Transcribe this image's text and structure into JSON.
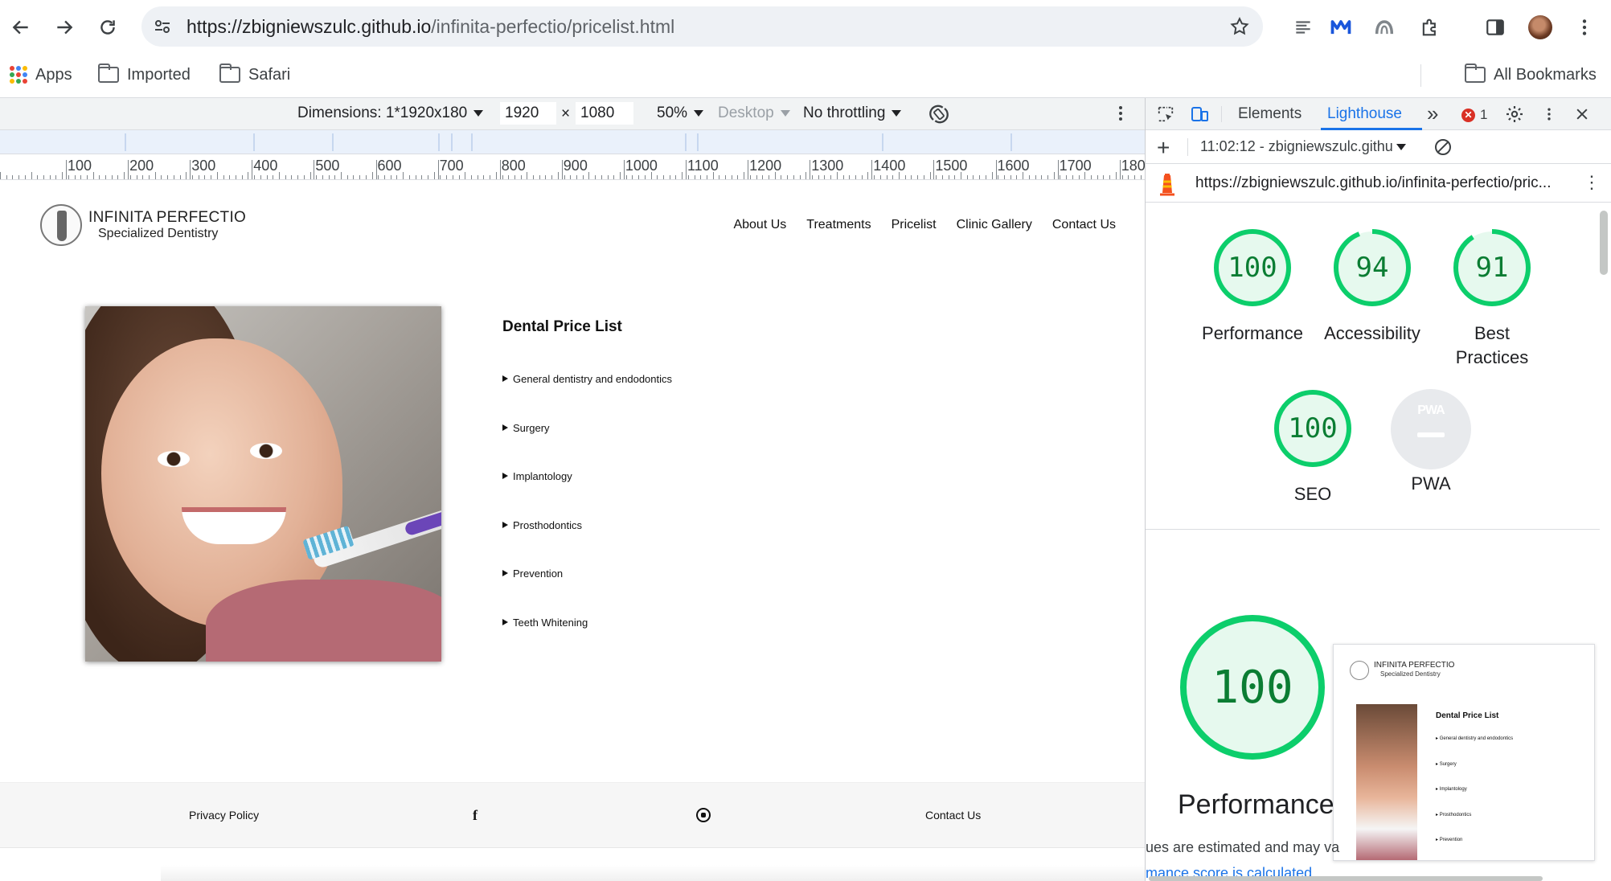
{
  "browser": {
    "url_host": "https://zbigniewszulc.github.io",
    "url_path": "/infinita-perfectio/pricelist.html",
    "bookmarks": [
      {
        "label": "Apps",
        "icon": "apps-grid-icon"
      },
      {
        "label": "Imported",
        "icon": "folder-icon"
      },
      {
        "label": "Safari",
        "icon": "folder-icon"
      }
    ],
    "all_bookmarks_label": "All Bookmarks",
    "colors": {
      "accent": "#1a73e8",
      "omnibox_bg": "#eef1f5"
    }
  },
  "device_toolbar": {
    "dimensions_label": "Dimensions: 1*1920x180",
    "width_value": "1920",
    "times": "×",
    "height_value": "1080",
    "zoom": "50%",
    "device_type": "Desktop",
    "throttling": "No throttling"
  },
  "ruler": {
    "labels": [
      "100",
      "200",
      "300",
      "400",
      "500",
      "600",
      "700",
      "800",
      "900",
      "1000",
      "1100",
      "1200",
      "1300",
      "1400",
      "1500",
      "1600",
      "1700",
      "1800"
    ]
  },
  "site": {
    "logo_line1": "INFINITA PERFECTIO",
    "logo_line2": "Specialized Dentistry",
    "nav": [
      "About Us",
      "Treatments",
      "Pricelist",
      "Clinic Gallery",
      "Contact Us"
    ],
    "price_title": "Dental Price List",
    "price_items": [
      "General dentistry and endodontics",
      "Surgery",
      "Implantology",
      "Prosthodontics",
      "Prevention",
      "Teeth Whitening"
    ],
    "footer": {
      "privacy": "Privacy Policy",
      "facebook_glyph": "f",
      "contact": "Contact Us"
    }
  },
  "devtools": {
    "tabs": {
      "elements": "Elements",
      "lighthouse": "Lighthouse",
      "more": "»",
      "error_count": "1"
    },
    "report_selector": "11:02:12 - zbigniewszulc.githu",
    "add_label": "+",
    "report_url": "https://zbigniewszulc.github.io/infinita-perfectio/pric...",
    "scores": [
      {
        "label": "Performance",
        "value": "100",
        "score": 100
      },
      {
        "label": "Accessibility",
        "value": "94",
        "score": 94
      },
      {
        "label": "Best",
        "label2": "Practices",
        "value": "91",
        "score": 91
      },
      {
        "label": "SEO",
        "value": "100",
        "score": 100
      }
    ],
    "pwa": {
      "badge": "PWA",
      "label": "PWA"
    },
    "main_score": {
      "value": "100",
      "label": "Performance",
      "score": 100
    },
    "note_line1": "ues are estimated and may va",
    "note_line2": "mance score is calculated",
    "thumbnail": {
      "logo_line1": "INFINITA PERFECTIO",
      "logo_line2": "Specialized Dentistry",
      "title": "Dental Price List",
      "items": [
        "General dentistry and endodontics",
        "Surgery",
        "Implantology",
        "Prosthodontics",
        "Prevention"
      ]
    },
    "colors": {
      "pass": "#0cce6b",
      "pass_text": "#0b7d33",
      "pass_fill": "#e6f9ee"
    }
  }
}
